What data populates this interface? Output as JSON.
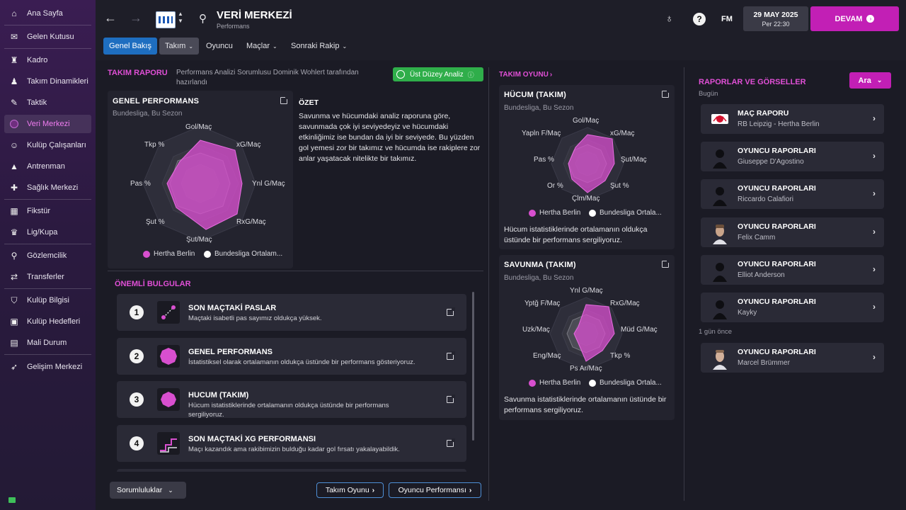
{
  "sidebar": {
    "items": [
      {
        "label": "Ana Sayfa",
        "icon": "home-icon"
      },
      {
        "label": "Gelen Kutusu",
        "icon": "inbox-icon"
      },
      {
        "label": "Kadro",
        "icon": "shirt-icon"
      },
      {
        "label": "Takım Dinamikleri",
        "icon": "people-icon"
      },
      {
        "label": "Taktik",
        "icon": "tactics-icon"
      },
      {
        "label": "Veri Merkezi",
        "icon": "data-hub-icon"
      },
      {
        "label": "Kulüp Çalışanları",
        "icon": "staff-icon"
      },
      {
        "label": "Antrenman",
        "icon": "training-icon"
      },
      {
        "label": "Sağlık Merkezi",
        "icon": "medical-icon"
      },
      {
        "label": "Fikstür",
        "icon": "calendar-icon"
      },
      {
        "label": "Lig/Kupa",
        "icon": "trophy-icon"
      },
      {
        "label": "Gözlemcilik",
        "icon": "scouting-icon"
      },
      {
        "label": "Transferler",
        "icon": "transfer-icon"
      },
      {
        "label": "Kulüp Bilgisi",
        "icon": "shield-icon"
      },
      {
        "label": "Kulüp Hedefleri",
        "icon": "briefcase-icon"
      },
      {
        "label": "Mali Durum",
        "icon": "finance-icon"
      },
      {
        "label": "Gelişim Merkezi",
        "icon": "development-icon"
      }
    ]
  },
  "header": {
    "title": "VERİ MERKEZİ",
    "subtitle": "Performans",
    "fm_label": "FM",
    "date": "29 MAY 2025",
    "time": "Per 22:30",
    "continue_label": "DEVAM"
  },
  "tabs": [
    {
      "label": "Genel Bakış"
    },
    {
      "label": "Takım"
    },
    {
      "label": "Oyuncu"
    },
    {
      "label": "Maçlar"
    },
    {
      "label": "Sonraki Rakip"
    }
  ],
  "team_report": {
    "heading": "TAKIM RAPORU",
    "byline": "Performans Analizi Sorumlusu Dominik Wohlert tarafından hazırlandı",
    "badge": "Üst Düzey Analiz",
    "general": {
      "title": "GENEL PERFORMANS",
      "subtitle": "Bundesliga, Bu Sezon",
      "axes": [
        "Gol/Maç",
        "xG/Maç",
        "Ynl G/Maç",
        "RxG/Maç",
        "Şut/Maç",
        "Şut %",
        "Pas %",
        "Tkp %"
      ],
      "legend": [
        "Hertha Berlin",
        "Bundesliga Ortalam..."
      ]
    },
    "summary_title": "ÖZET",
    "summary_text": "Savunma ve hücumdaki analiz raporuna göre, savunmada çok iyi seviyedeyiz ve hücumdaki etkinliğimiz ise bundan da iyi bir seviyede. Bu yüzden gol yemesi zor bir takımız ve hücumda ise rakiplere zor anlar yaşatacak nitelikte bir takımız."
  },
  "findings": {
    "heading": "ÖNEMLİ BULGULAR",
    "items": [
      {
        "num": "1",
        "title": "SON MAÇTAKİ PASLAR",
        "desc": "Maçtaki isabetli pas sayımız oldukça yüksek."
      },
      {
        "num": "2",
        "title": "GENEL PERFORMANS",
        "desc": "İstatistiksel olarak ortalamanın oldukça üstünde bir performans gösteriyoruz."
      },
      {
        "num": "3",
        "title": "HUCUM (TAKIM)",
        "desc": "Hücum istatistiklerinde ortalamanın oldukça üstünde bir performans sergiliyoruz."
      },
      {
        "num": "4",
        "title": "SON MAÇTAKİ XG PERFORMANSI",
        "desc": "Maçı kazandık ama rakibimizin bulduğu kadar gol fırsatı yakalayabildik."
      }
    ]
  },
  "footer": {
    "responsibilities": "Sorumluluklar",
    "team_play_btn": "Takım Oyunu",
    "player_perf_btn": "Oyuncu Performansı"
  },
  "team_play": {
    "heading": "TAKIM OYUNU",
    "attack": {
      "title": "HÜCUM (TAKIM)",
      "subtitle": "Bundesliga, Bu Sezon",
      "axes": [
        "Gol/Maç",
        "xG/Maç",
        "Şut/Maç",
        "Şut %",
        "Çlm/Maç",
        "Or %",
        "Pas %",
        "Yapln F/Maç"
      ],
      "legend": [
        "Hertha Berlin",
        "Bundesliga Ortala..."
      ],
      "note": "Hücum istatistiklerinde ortalamanın oldukça üstünde bir performans sergiliyoruz."
    },
    "defense": {
      "title": "SAVUNMA (TAKIM)",
      "subtitle": "Bundesliga, Bu Sezon",
      "axes": [
        "Ynl G/Maç",
        "RxG/Maç",
        "Müd G/Maç",
        "Tkp %",
        "Ps Ar/Maç",
        "Eng/Maç",
        "Uzk/Maç",
        "Yptğ F/Maç"
      ],
      "legend": [
        "Hertha Berlin",
        "Bundesliga Ortala..."
      ],
      "note": "Savunma istatistiklerinde ortalamanın üstünde bir performans sergiliyoruz."
    }
  },
  "reports": {
    "heading": "RAPORLAR VE GÖRSELLER",
    "search_label": "Ara",
    "today": "Bugün",
    "one_day_ago": "1 gün önce",
    "items": [
      {
        "title": "MAÇ RAPORU",
        "sub": "RB Leipzig - Hertha Berlin"
      },
      {
        "title": "OYUNCU RAPORLARI",
        "sub": "Giuseppe D'Agostino"
      },
      {
        "title": "OYUNCU RAPORLARI",
        "sub": "Riccardo Calafiori"
      },
      {
        "title": "OYUNCU RAPORLARI",
        "sub": "Felix Camm"
      },
      {
        "title": "OYUNCU RAPORLARI",
        "sub": "Elliot Anderson"
      },
      {
        "title": "OYUNCU RAPORLARI",
        "sub": "Kayky"
      },
      {
        "title": "OYUNCU RAPORLARI",
        "sub": "Marcel Brümmer"
      }
    ]
  },
  "colors": {
    "accent": "#c21fb5",
    "team": "#d84fcf",
    "average": "#ffffff",
    "tab_primary": "#1e6ec0",
    "badge": "#2fae4a"
  }
}
